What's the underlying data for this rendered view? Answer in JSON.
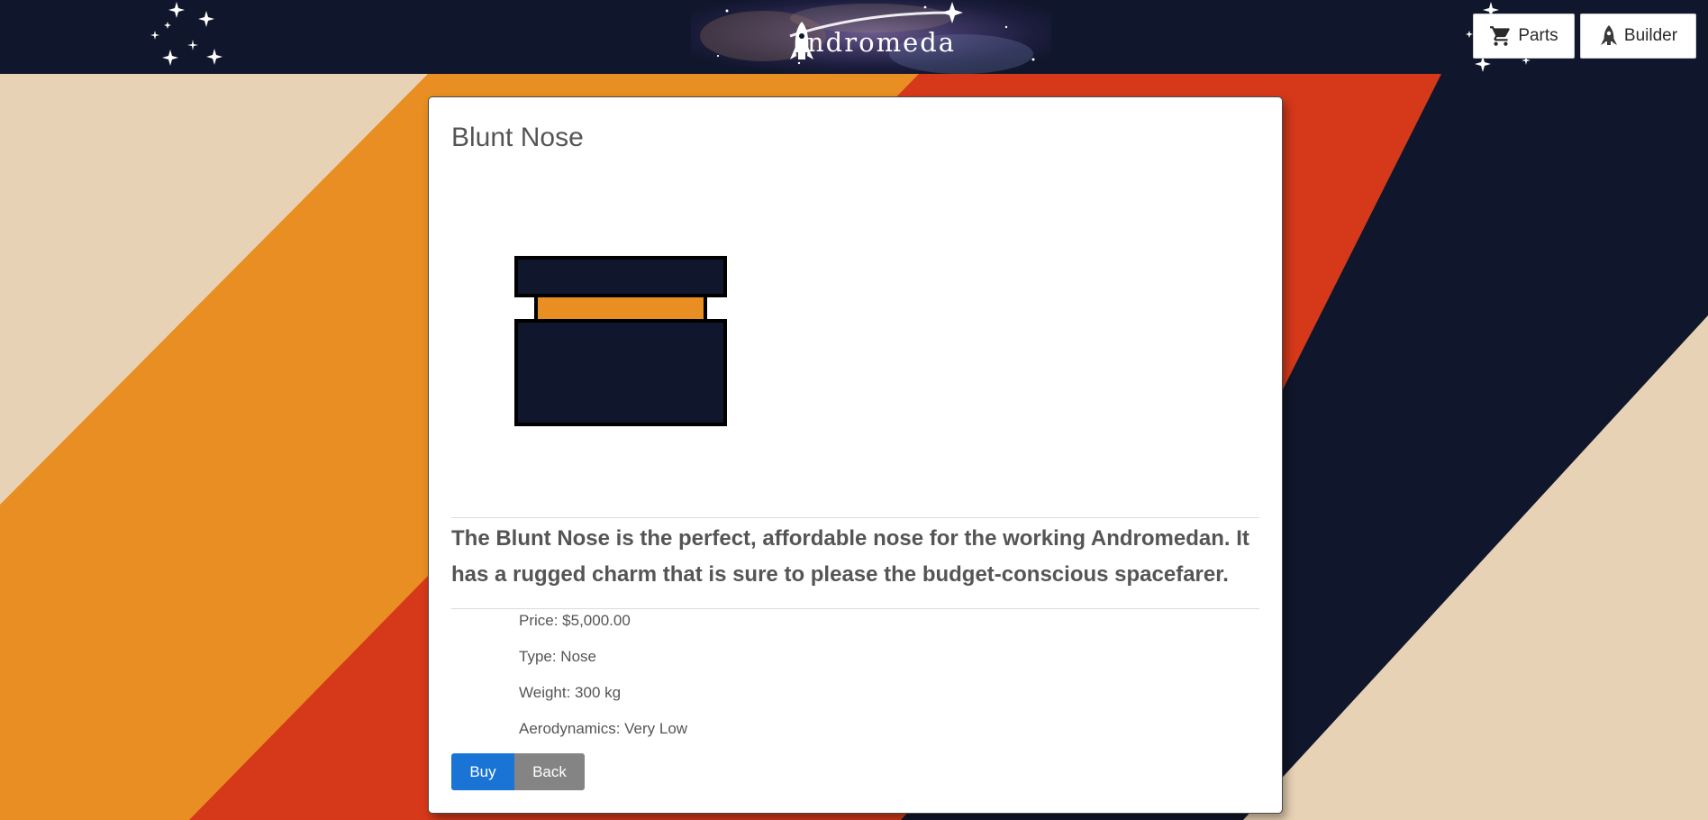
{
  "header": {
    "logo_text": "ndromeda",
    "nav": {
      "parts_label": "Parts",
      "builder_label": "Builder"
    }
  },
  "part": {
    "title": "Blunt Nose",
    "description": "The Blunt Nose is the perfect, affordable nose for the working Andromedan. It has a rugged charm that is sure to please the budget-conscious spacefarer.",
    "price": "Price: $5,000.00",
    "type": "Type: Nose",
    "weight": "Weight: 300 kg",
    "aerodynamics": "Aerodynamics: Very Low"
  },
  "actions": {
    "buy_label": "Buy",
    "back_label": "Back"
  },
  "icons": {
    "cart": "cart-icon",
    "rocket": "rocket-icon",
    "logo_rocket": "rocket-logo-icon"
  },
  "colors": {
    "header_bg": "#10162b",
    "beige": "#e8d2b5",
    "orange": "#e88e22",
    "red": "#d5391a",
    "navy": "#10162b",
    "primary_button": "#1a74d6",
    "secondary_button": "#848484"
  }
}
